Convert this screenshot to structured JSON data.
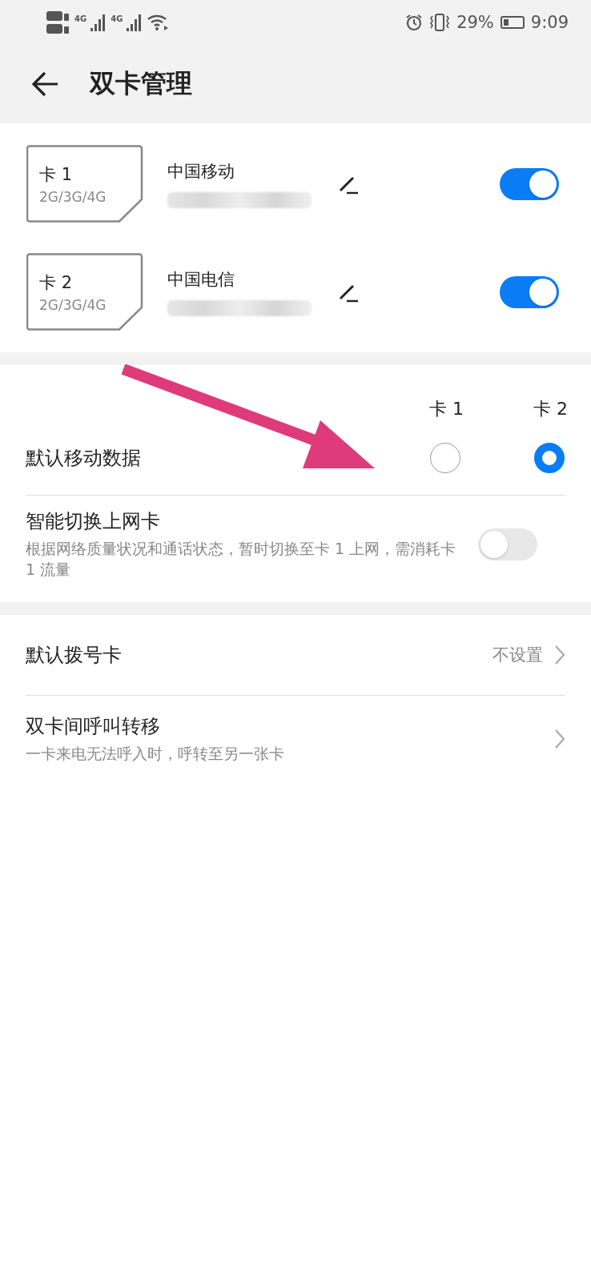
{
  "status_bar": {
    "networks": [
      "4G",
      "4G"
    ],
    "battery_percent": "29%",
    "battery": {
      "level": 0.29
    },
    "time": "9:09"
  },
  "header": {
    "title": "双卡管理"
  },
  "sims": [
    {
      "slot": "卡 1",
      "bands": "2G/3G/4G",
      "carrier": "中国移动",
      "on": true
    },
    {
      "slot": "卡 2",
      "bands": "2G/3G/4G",
      "carrier": "中国电信",
      "on": true
    }
  ],
  "default_data": {
    "columns": [
      "卡 1",
      "卡 2"
    ],
    "label": "默认移动数据",
    "options": [
      {
        "selected": false
      },
      {
        "selected": true
      }
    ]
  },
  "smart_switch": {
    "title": "智能切换上网卡",
    "description": "根据网络质量状况和通话状态，暂时切换至卡 1 上网，需消耗卡 1 流量",
    "on": false
  },
  "rows": [
    {
      "title": "默认拨号卡",
      "value": "不设置"
    },
    {
      "title": "双卡间呼叫转移",
      "subtitle": "一卡来电无法呼入时，呼转至另一张卡"
    }
  ]
}
